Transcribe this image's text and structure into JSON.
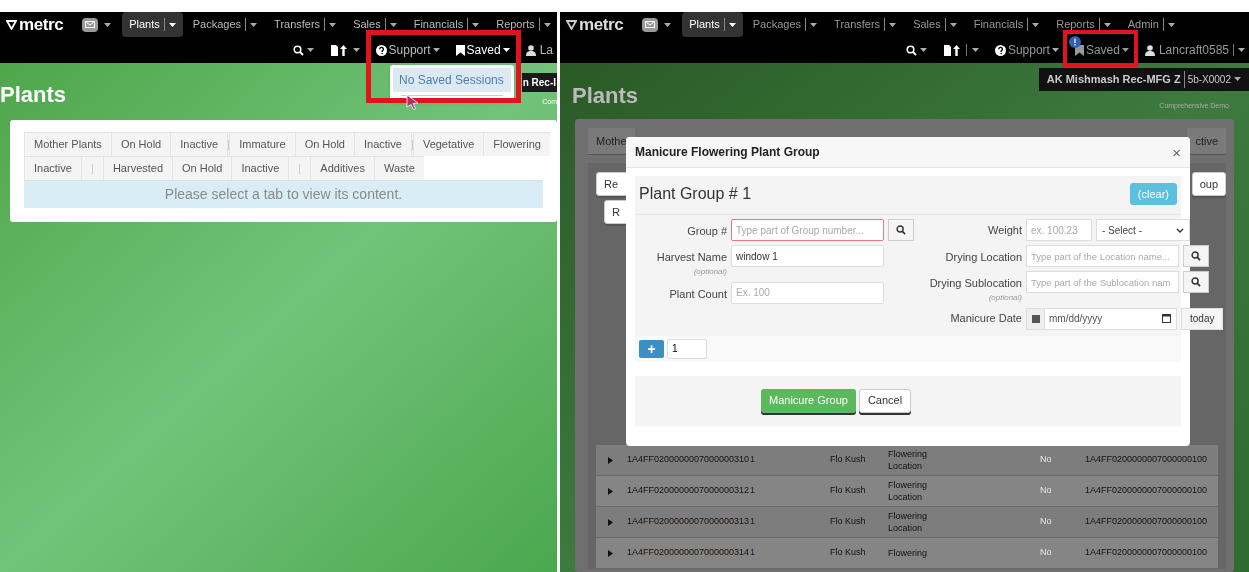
{
  "left_screen": {
    "nav": {
      "logo": "metrc",
      "menus": [
        {
          "label": "Plants",
          "selected": true
        },
        {
          "label": "Packages",
          "selected": false
        },
        {
          "label": "Transfers",
          "selected": false
        },
        {
          "label": "Sales",
          "selected": false
        },
        {
          "label": "Financials",
          "selected": false
        },
        {
          "label": "Reports",
          "selected": false
        }
      ],
      "support": "Support",
      "saved": "Saved",
      "saved_alert": false,
      "user": "La"
    },
    "saved_menu": {
      "items": [
        "No Saved Sessions"
      ]
    },
    "facility": "n Rec-I",
    "facility_note": "Com",
    "page_title": "Plants",
    "tab_rows": [
      [
        {
          "kind": "tab",
          "label": "Mother Plants",
          "selected": false
        },
        {
          "kind": "tab",
          "label": "On Hold",
          "selected": false
        },
        {
          "kind": "tab",
          "label": "Inactive",
          "selected": false
        },
        {
          "kind": "separator"
        },
        {
          "kind": "tab",
          "label": "Immature",
          "selected": false
        },
        {
          "kind": "tab",
          "label": "On Hold",
          "selected": false
        },
        {
          "kind": "tab",
          "label": "Inactive",
          "selected": false
        },
        {
          "kind": "separator"
        },
        {
          "kind": "tab",
          "label": "Vegetative",
          "selected": false
        },
        {
          "kind": "tab",
          "label": "Flowering",
          "selected": false
        }
      ],
      [
        {
          "kind": "tab",
          "label": "Inactive",
          "selected": false
        },
        {
          "kind": "separator"
        },
        {
          "kind": "tab",
          "label": "Harvested",
          "selected": false
        },
        {
          "kind": "tab",
          "label": "On Hold",
          "selected": false
        },
        {
          "kind": "tab",
          "label": "Inactive",
          "selected": false
        },
        {
          "kind": "separator"
        },
        {
          "kind": "tab",
          "label": "Additives",
          "selected": false
        },
        {
          "kind": "tab",
          "label": "Waste",
          "selected": false
        }
      ]
    ],
    "message": "Please select a tab to view its content."
  },
  "right_screen": {
    "nav": {
      "logo": "metrc",
      "menus": [
        {
          "label": "Plants",
          "selected": true
        },
        {
          "label": "Packages",
          "selected": false
        },
        {
          "label": "Transfers",
          "selected": false
        },
        {
          "label": "Sales",
          "selected": false
        },
        {
          "label": "Financials",
          "selected": false
        },
        {
          "label": "Reports",
          "selected": false
        },
        {
          "label": "Admin",
          "selected": false
        }
      ],
      "support": "Support",
      "saved": "Saved",
      "saved_alert": true,
      "user": "Lancraft0585"
    },
    "facility": "AK Mishmash Rec-MFG Z",
    "license": "5b-X0002",
    "facility_note": "Comprehensive Demo",
    "page_title": "Plants",
    "tab_left": "Mothe",
    "tab_right": "ctive",
    "button_fragments": [
      "Re",
      "R"
    ],
    "button_right": "oup",
    "rows": [
      {
        "column_2": "1A4FF0200000007000000310",
        "column_3": "1",
        "column_4": "Flo Kush",
        "column_5": "Flowering Location",
        "column_7": "No",
        "column_8": "1A4FF0200000007000000100"
      },
      {
        "column_2": "1A4FF0200000007000000312",
        "column_3": "1",
        "column_4": "Flo Kush",
        "column_5": "Flowering Location",
        "column_7": "No",
        "column_8": "1A4FF0200000007000000100"
      },
      {
        "column_2": "1A4FF0200000007000000313",
        "column_3": "1",
        "column_4": "Flo Kush",
        "column_5": "Flowering Location",
        "column_7": "No",
        "column_8": "1A4FF0200000007000000100"
      },
      {
        "column_2": "1A4FF0200000007000000314",
        "column_3": "1",
        "column_4": "Flo Kush",
        "column_5": "Flowering",
        "column_7": "No",
        "column_8": "1A4FF0200000007000000100"
      }
    ],
    "modal": {
      "title": "Manicure Flowering Plant Group",
      "close": "×",
      "group_title": "Plant Group # 1",
      "clear": "(clear)",
      "left_fields": [
        {
          "label": "Group #",
          "placeholder": "Type part of Group number...",
          "invalid": true,
          "search": true
        },
        {
          "label": "Harvest Name",
          "value": "window 1",
          "note": "(optional)",
          "invalid": false,
          "search": false
        },
        {
          "label": "Plant Count",
          "placeholder": "Ex. 100",
          "invalid": false,
          "search": false
        }
      ],
      "weight": {
        "label": "Weight",
        "placeholder": "ex. 100.23",
        "select": "- Select -"
      },
      "right_fields": [
        {
          "label": "Drying Location",
          "placeholder": "Type part of the Location name..."
        },
        {
          "label": "Drying Sublocation",
          "placeholder": "Type part of the Sublocation nam",
          "note": "(optional)"
        }
      ],
      "date": {
        "label": "Manicure Date",
        "placeholder": "mm/dd/yyyy",
        "button": "today"
      },
      "add": {
        "button": "+",
        "count": "1"
      },
      "buttons": {
        "primary": "Manicure Group",
        "secondary": "Cancel"
      }
    }
  }
}
